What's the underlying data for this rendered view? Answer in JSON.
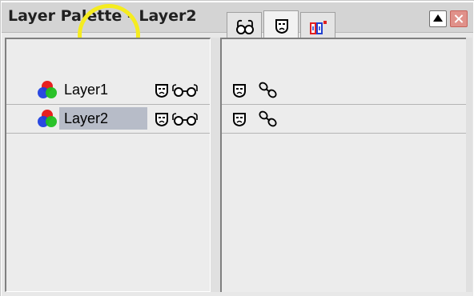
{
  "window": {
    "title": "Layer Palette - Layer2",
    "minimize_icon": "minimize-icon",
    "close_icon": "close-icon"
  },
  "toolbar": {
    "buttons": [
      {
        "name": "new-layer",
        "icon": "new-layer-icon"
      },
      {
        "name": "delete-layer",
        "icon": "trash-icon"
      },
      {
        "name": "mask-from-selection",
        "icon": "new-mask-icon"
      }
    ]
  },
  "tabs": [
    {
      "name": "tab-visibility",
      "icon": "glasses-icon",
      "active": false
    },
    {
      "name": "tab-mask",
      "icon": "mask-icon",
      "active": true
    },
    {
      "name": "tab-blend",
      "icon": "blend-icon",
      "active": false
    }
  ],
  "layers": [
    {
      "label": "Layer1",
      "selected": false
    },
    {
      "label": "Layer2",
      "selected": true
    }
  ],
  "colors": {
    "highlight_ring": "#f5ec1f",
    "selected_row": "#b7bcc8",
    "close_button": "#e0918a"
  }
}
